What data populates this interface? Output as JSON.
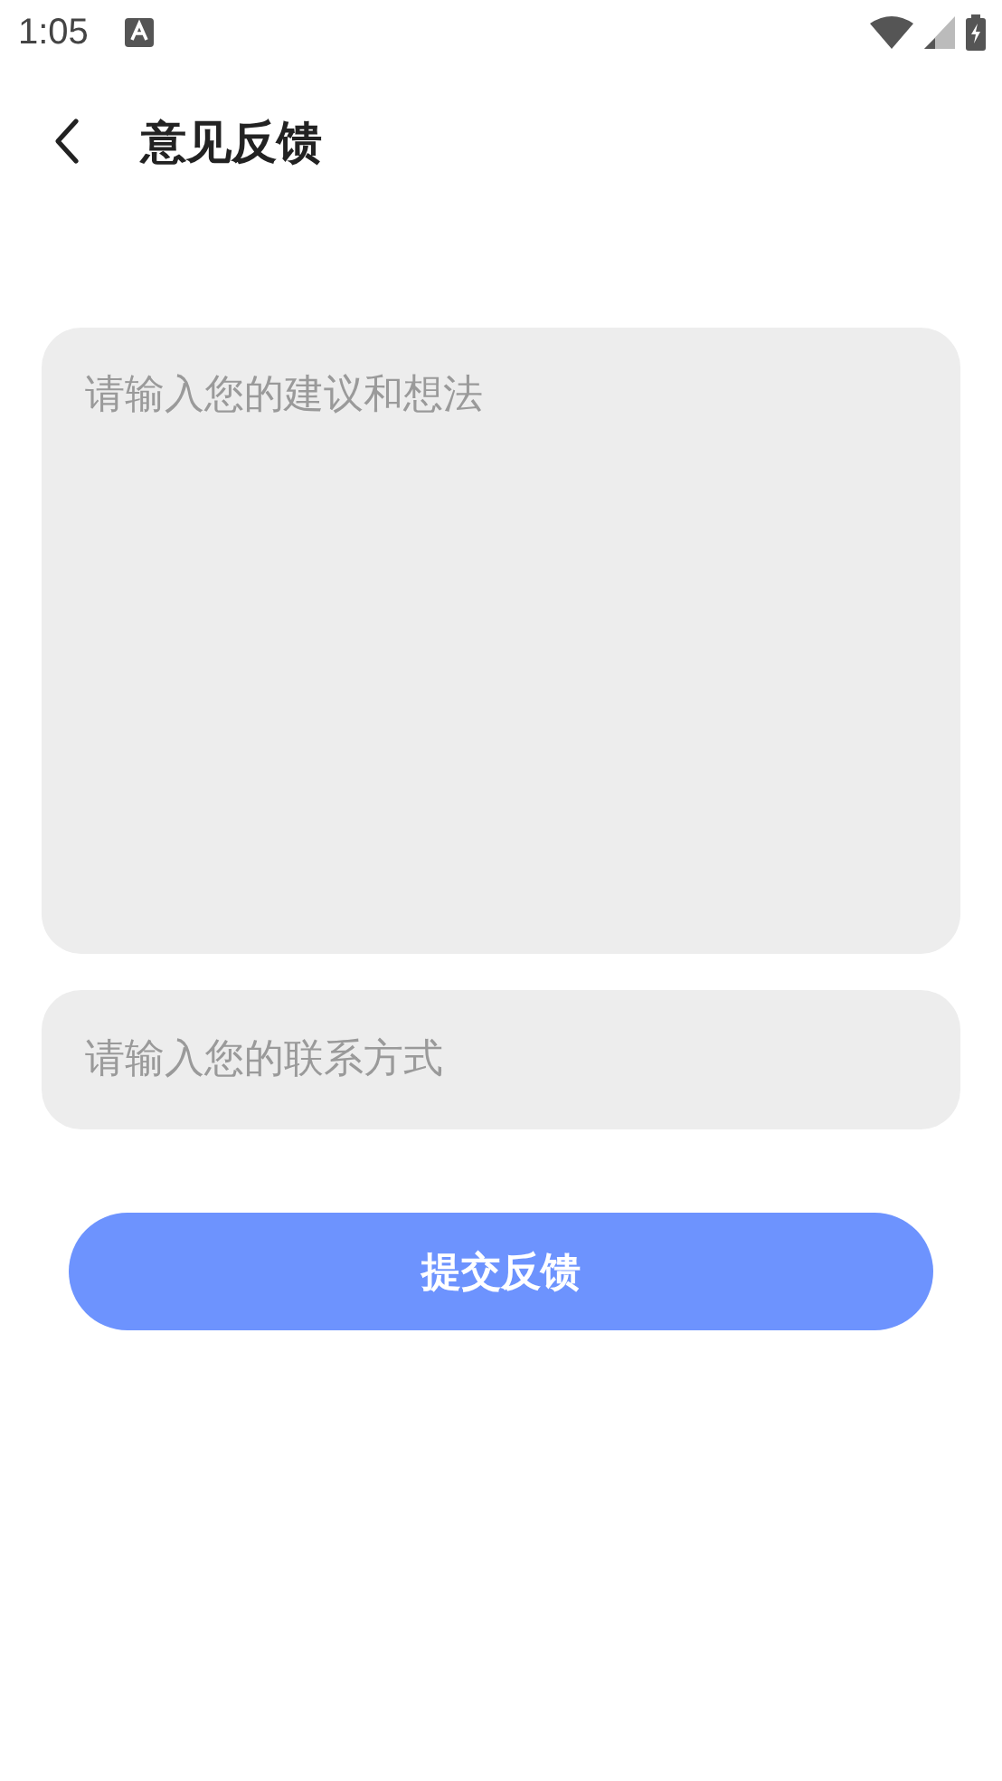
{
  "status_bar": {
    "time": "1:05"
  },
  "header": {
    "title": "意见反馈"
  },
  "form": {
    "suggestion": {
      "placeholder": "请输入您的建议和想法"
    },
    "contact": {
      "placeholder": "请输入您的联系方式"
    },
    "submit": {
      "label": "提交反馈"
    }
  }
}
